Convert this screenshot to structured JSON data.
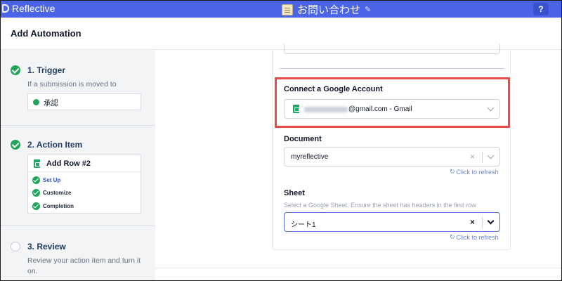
{
  "app": {
    "logo_text": "Reflective",
    "form_title": "お問い合わせ",
    "help_label": "?"
  },
  "header": {
    "title": "Add Automation"
  },
  "steps": {
    "trigger": {
      "title": "1. Trigger",
      "subtitle": "If a submission is moved to",
      "status_value": "承認"
    },
    "action": {
      "title": "2. Action Item",
      "item_label": "Add Row #2",
      "substeps": [
        "Set Up",
        "Customize",
        "Completion"
      ]
    },
    "review": {
      "title": "3. Review",
      "subtitle_line1": "Review your action item and turn it",
      "subtitle_line2": "on."
    }
  },
  "form": {
    "account": {
      "label": "Connect a Google Account",
      "email_suffix": "@gmail.com - Gmail"
    },
    "document": {
      "label": "Document",
      "value": "myreflective",
      "clear": "×",
      "refresh": "Click to refresh"
    },
    "sheet": {
      "label": "Sheet",
      "help": "Select a Google Sheet. Ensure the sheet has headers in the first row",
      "value": "シート1",
      "clear": "×",
      "refresh": "Click to refresh"
    }
  },
  "colors": {
    "topbar": "#4a63e7",
    "success": "#22a55b",
    "highlight": "#e94b4b",
    "link": "#6b85c8"
  },
  "icons": [
    "logo-icon",
    "memo-icon",
    "pencil-icon",
    "check-icon",
    "sheets-icon",
    "chevron-down-icon",
    "clear-icon",
    "refresh-icon"
  ]
}
